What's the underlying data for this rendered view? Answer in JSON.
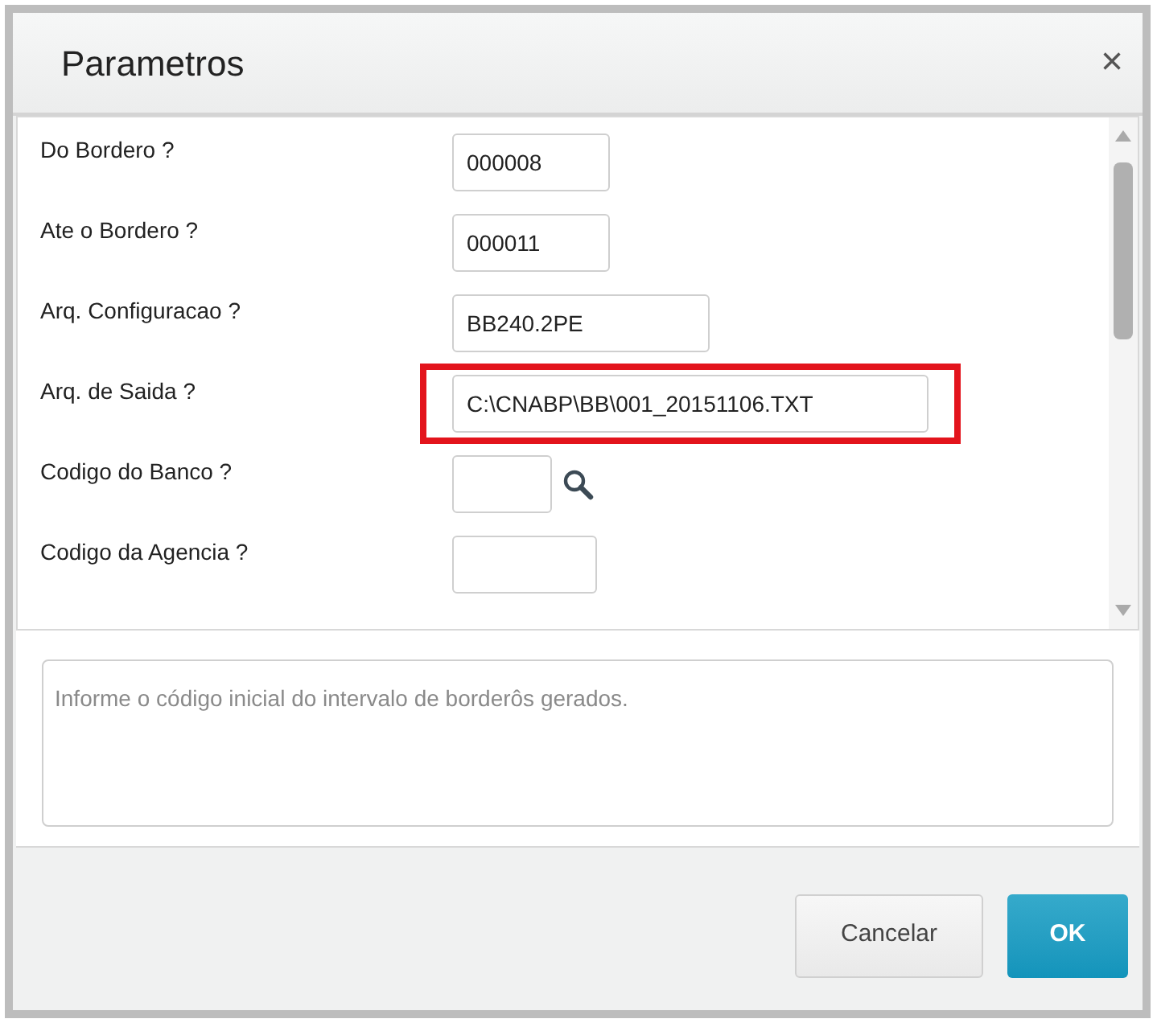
{
  "window": {
    "title": "Parametros",
    "close": "×"
  },
  "fields": [
    {
      "label": "Do Bordero ?",
      "value": "000008",
      "kind": "text",
      "highlighted": false
    },
    {
      "label": "Ate o Bordero ?",
      "value": "000011",
      "kind": "text",
      "highlighted": false
    },
    {
      "label": "Arq. Configuracao ?",
      "value": "BB240.2PE",
      "kind": "text",
      "highlighted": false
    },
    {
      "label": "Arq. de Saida ?",
      "value": "C:\\CNABP\\BB\\001_20151106.TXT",
      "kind": "text",
      "highlighted": true
    },
    {
      "label": "Codigo do Banco ?",
      "kind": "lookup",
      "highlighted": false
    },
    {
      "label": "Codigo da Agencia ?",
      "kind": "text",
      "highlighted": false
    }
  ],
  "help_text": "Informe o código inicial do intervalo de borderôs gerados.",
  "buttons": [
    {
      "label": "Cancelar",
      "kind": "secondary"
    },
    {
      "label": "OK",
      "kind": "primary"
    }
  ]
}
